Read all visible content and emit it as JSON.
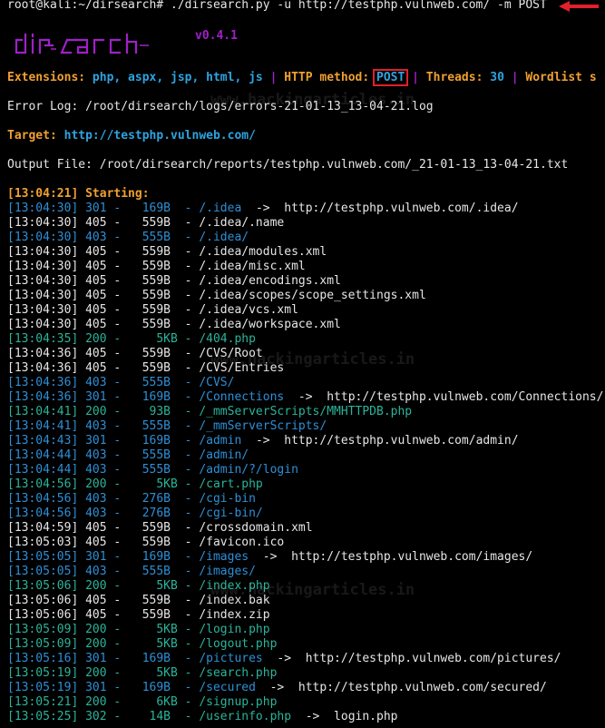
{
  "command": "root@kali:~/dirsearch# ./dirsearch.py -u http://testphp.vulnweb.com/ -m POST",
  "version": "v0.4.1",
  "info": {
    "ext_label": "Extensions:",
    "ext_value": "php, aspx, jsp, html, js",
    "sep": "|",
    "method_label": "HTTP method:",
    "method_value": "POST",
    "threads_label": "Threads:",
    "threads_value": "30",
    "wordlist_label": "Wordlist s"
  },
  "error_log": "Error Log: /root/dirsearch/logs/errors-21-01-13_13-04-21.log",
  "target_label": "Target:",
  "target_value": "http://testphp.vulnweb.com/",
  "output_file": "Output File: /root/dirsearch/reports/testphp.vulnweb.com/_21-01-13_13-04-21.txt",
  "starting": "[13:04:21] Starting:",
  "watermark": "www.hackingarticles.in",
  "colors": {
    "orange": "#f0a030",
    "cyan": "#2ea3e0",
    "purple": "#a020c8",
    "teal": "#2bb39a",
    "red": "#e0202a"
  },
  "results": [
    {
      "text": "[13:04:30] 301 -   169B  - /.idea  ",
      "redirect": "->  http://testphp.vulnweb.com/.idea/",
      "status": "301"
    },
    {
      "text": "[13:04:30] 405 -   559B  - /.idea/.name",
      "status": "405"
    },
    {
      "text": "[13:04:30] 403 -   555B  - /.idea/",
      "status": "403"
    },
    {
      "text": "[13:04:30] 405 -   559B  - /.idea/modules.xml",
      "status": "405"
    },
    {
      "text": "[13:04:30] 405 -   559B  - /.idea/misc.xml",
      "status": "405"
    },
    {
      "text": "[13:04:30] 405 -   559B  - /.idea/encodings.xml",
      "status": "405"
    },
    {
      "text": "[13:04:30] 405 -   559B  - /.idea/scopes/scope_settings.xml",
      "status": "405"
    },
    {
      "text": "[13:04:30] 405 -   559B  - /.idea/vcs.xml",
      "status": "405"
    },
    {
      "text": "[13:04:30] 405 -   559B  - /.idea/workspace.xml",
      "status": "405"
    },
    {
      "text": "[13:04:35] 200 -     5KB - /404.php",
      "status": "200"
    },
    {
      "text": "[13:04:36] 405 -   559B  - /CVS/Root",
      "status": "405"
    },
    {
      "text": "[13:04:36] 405 -   559B  - /CVS/Entries",
      "status": "405"
    },
    {
      "text": "[13:04:36] 403 -   555B  - /CVS/",
      "status": "403"
    },
    {
      "text": "[13:04:36] 301 -   169B  - /Connections  ",
      "redirect": "->  http://testphp.vulnweb.com/Connections/",
      "status": "301"
    },
    {
      "text": "[13:04:41] 200 -    93B  - /_mmServerScripts/MMHTTPDB.php",
      "status": "200"
    },
    {
      "text": "[13:04:41] 403 -   555B  - /_mmServerScripts/",
      "status": "403"
    },
    {
      "text": "[13:04:43] 301 -   169B  - /admin  ",
      "redirect": "->  http://testphp.vulnweb.com/admin/",
      "status": "301"
    },
    {
      "text": "[13:04:44] 403 -   555B  - /admin/",
      "status": "403"
    },
    {
      "text": "[13:04:44] 403 -   555B  - /admin/?/login",
      "status": "403"
    },
    {
      "text": "[13:04:56] 200 -     5KB - /cart.php",
      "status": "200"
    },
    {
      "text": "[13:04:56] 403 -   276B  - /cgi-bin",
      "status": "403"
    },
    {
      "text": "[13:04:56] 403 -   276B  - /cgi-bin/",
      "status": "403"
    },
    {
      "text": "[13:04:59] 405 -   559B  - /crossdomain.xml",
      "status": "405"
    },
    {
      "text": "[13:05:03] 405 -   559B  - /favicon.ico",
      "status": "405"
    },
    {
      "text": "[13:05:05] 301 -   169B  - /images  ",
      "redirect": "->  http://testphp.vulnweb.com/images/",
      "status": "301"
    },
    {
      "text": "[13:05:05] 403 -   555B  - /images/",
      "status": "403"
    },
    {
      "text": "[13:05:06] 200 -     5KB - /index.php",
      "status": "200"
    },
    {
      "text": "[13:05:06] 405 -   559B  - /index.bak",
      "status": "405"
    },
    {
      "text": "[13:05:06] 405 -   559B  - /index.zip",
      "status": "405"
    },
    {
      "text": "[13:05:09] 200 -     5KB - /login.php",
      "status": "200"
    },
    {
      "text": "[13:05:09] 200 -     5KB - /logout.php",
      "status": "200"
    },
    {
      "text": "[13:05:16] 301 -   169B  - /pictures  ",
      "redirect": "->  http://testphp.vulnweb.com/pictures/",
      "status": "301"
    },
    {
      "text": "[13:05:19] 200 -     5KB - /search.php",
      "status": "200"
    },
    {
      "text": "[13:05:19] 301 -   169B  - /secured  ",
      "redirect": "->  http://testphp.vulnweb.com/secured/",
      "status": "301"
    },
    {
      "text": "[13:05:21] 200 -     6KB - /signup.php",
      "status": "200"
    },
    {
      "text": "[13:05:25] 302 -    14B  - /userinfo.php  ",
      "redirect": "->  login.php",
      "status": "302"
    }
  ]
}
